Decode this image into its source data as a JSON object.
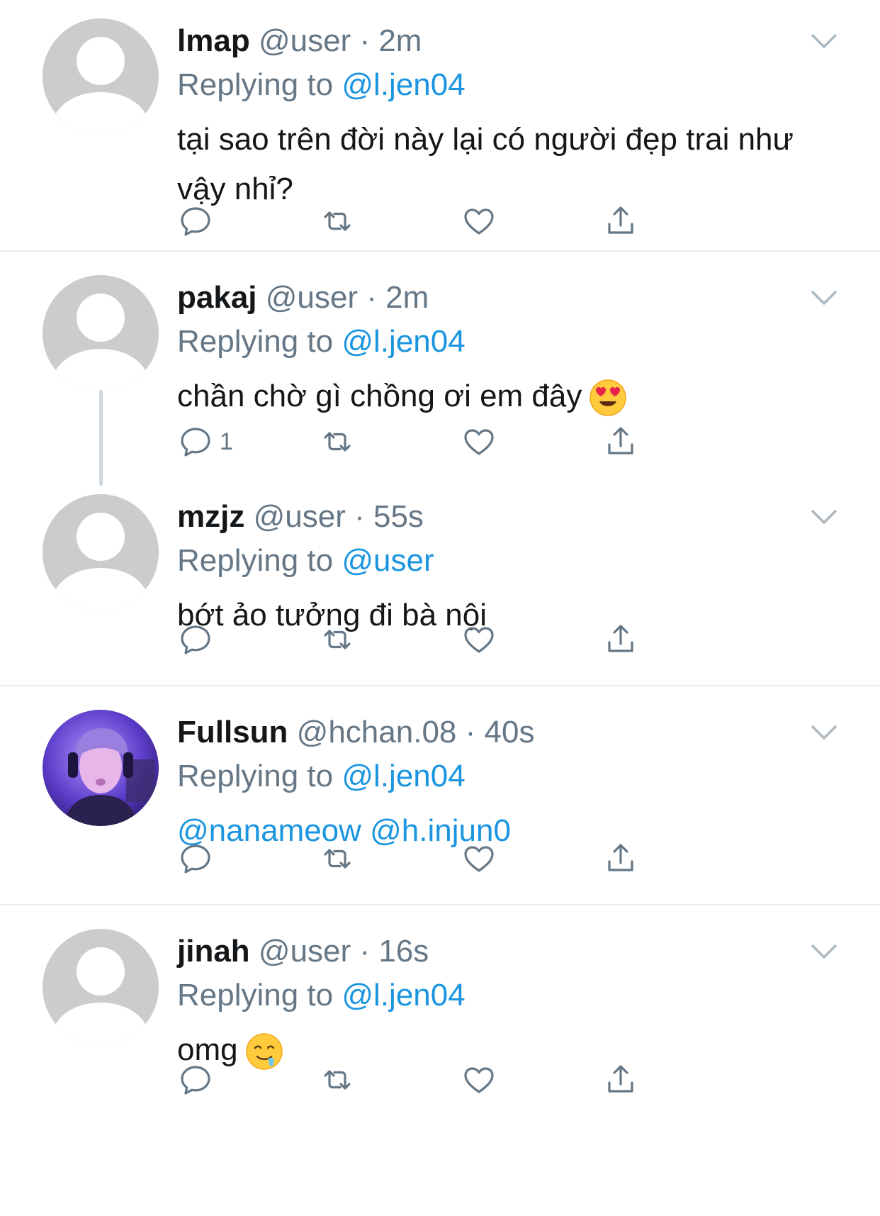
{
  "colors": {
    "text": "#14171a",
    "secondary": "#657786",
    "link": "#1b95e0",
    "divider": "#e6ecf0",
    "icon": "#657786",
    "default_avatar_bg": "#cccccc"
  },
  "tweets": [
    {
      "name": "lmap",
      "handle": "@user",
      "sep": "·",
      "time": "2m",
      "replying_prefix": "Replying to",
      "replying_to": "@l.jen04",
      "text": "tại sao trên đời này lại có người đẹp trai như vậy nhỉ?",
      "reply_count": "",
      "avatar": "default-avatar-icon"
    },
    {
      "name": "pakaj",
      "handle": "@user",
      "sep": "·",
      "time": "2m",
      "replying_prefix": "Replying to",
      "replying_to": "@l.jen04",
      "text": "chần chờ gì chồng ơi em đây",
      "emoji": "heart-eyes-emoji",
      "reply_count": "1",
      "avatar": "default-avatar-icon"
    },
    {
      "name": "mzjz",
      "handle": "@user",
      "sep": "·",
      "time": "55s",
      "replying_prefix": "Replying to",
      "replying_to": "@user",
      "text": "bớt ảo tưởng đi bà nội",
      "reply_count": "",
      "avatar": "default-avatar-icon"
    },
    {
      "name": "Fullsun",
      "handle": "@hchan.08",
      "sep": "·",
      "time": "40s",
      "replying_prefix": "Replying to",
      "replying_to": "@l.jen04",
      "text_mentions": "@nanameow @h.injun0",
      "reply_count": "",
      "avatar": "profile-photo"
    },
    {
      "name": "jinah",
      "handle": "@user",
      "sep": "·",
      "time": "16s",
      "replying_prefix": "Replying to",
      "replying_to": "@l.jen04",
      "text": "omg",
      "emoji": "drooling-face-emoji",
      "reply_count": "",
      "avatar": "default-avatar-icon"
    }
  ]
}
